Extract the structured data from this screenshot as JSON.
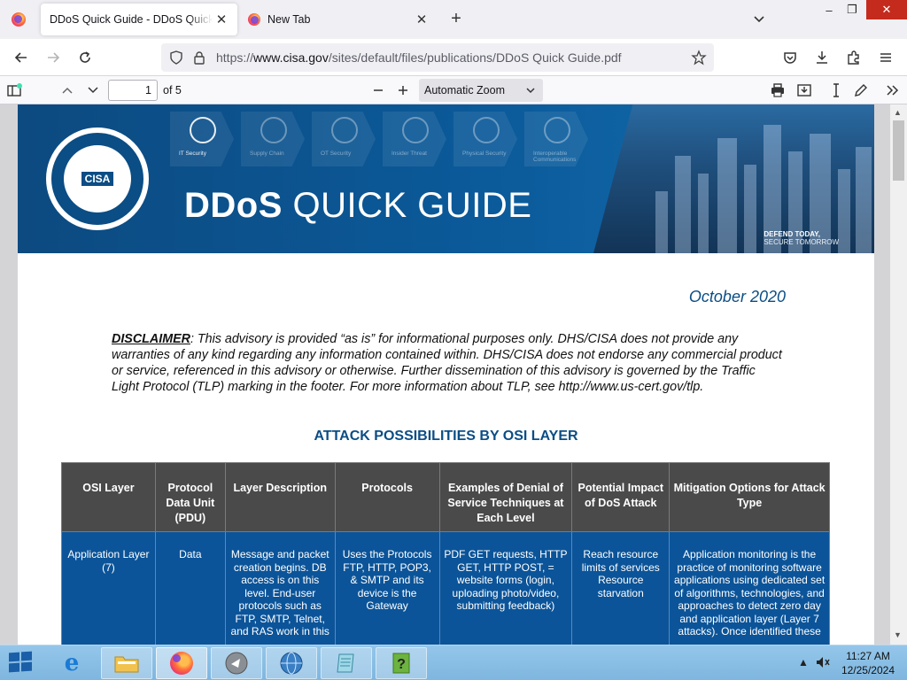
{
  "browser": {
    "tabs": [
      {
        "title": "DDoS Quick Guide - DDoS Quick Guide",
        "active": true
      },
      {
        "title": "New Tab",
        "active": false
      }
    ],
    "window_controls": {
      "minimize": "–",
      "restore": "❐",
      "close": "✕"
    },
    "url": {
      "scheme": "https://",
      "host": "www.cisa.gov",
      "path": "/sites/default/files/publications/DDoS Quick Guide.pdf"
    }
  },
  "pdf_toolbar": {
    "page_number": "1",
    "page_count": "of 5",
    "zoom": "Automatic Zoom"
  },
  "document": {
    "banner": {
      "seal_text": "CISA",
      "title_bold": "DDoS",
      "title_rest": "QUICK GUIDE",
      "tagline_1": "DEFEND TODAY,",
      "tagline_2": "SECURE TOMORROW",
      "icon_captions": [
        "IT Security",
        "Supply Chain",
        "OT Security",
        "Insider Threat",
        "Physical Security",
        "Interoperable Communications"
      ]
    },
    "date": "October 2020",
    "disclaimer_label": "DISCLAIMER",
    "disclaimer_text": ": This advisory is provided “as is” for informational purposes only. DHS/CISA does not provide any warranties of any kind regarding any information contained within. DHS/CISA does not endorse any commercial product or service, referenced in this advisory or otherwise. Further dissemination of this advisory is governed by the Traffic Light Protocol (TLP) marking in the footer. For more information about TLP, see http://www.us-cert.gov/tlp.",
    "section_heading": "ATTACK POSSIBILITIES BY OSI LAYER",
    "table": {
      "headers": [
        "OSI Layer",
        "Protocol Data Unit (PDU)",
        "Layer Description",
        "Protocols",
        "Examples of Denial of Service Techniques at Each Level",
        "Potential Impact of DoS Attack",
        "Mitigation Options for Attack Type"
      ],
      "rows": [
        [
          "Application Layer (7)",
          "Data",
          "Message and packet creation begins. DB access is on this level. End-user protocols such as FTP, SMTP, Telnet, and RAS work in this",
          "Uses the Protocols FTP, HTTP, POP3, & SMTP and its device is the Gateway",
          "PDF GET requests, HTTP GET, HTTP POST, = website forms (login, uploading photo/video, submitting feedback)",
          "Reach resource limits of services Resource starvation",
          "Application monitoring is the practice of monitoring software applications using dedicated set of algorithms, technologies, and approaches to detect zero day and application layer (Layer 7 attacks). Once identified these"
        ]
      ]
    }
  },
  "taskbar": {
    "time": "11:27 AM",
    "date": "12/25/2024"
  }
}
